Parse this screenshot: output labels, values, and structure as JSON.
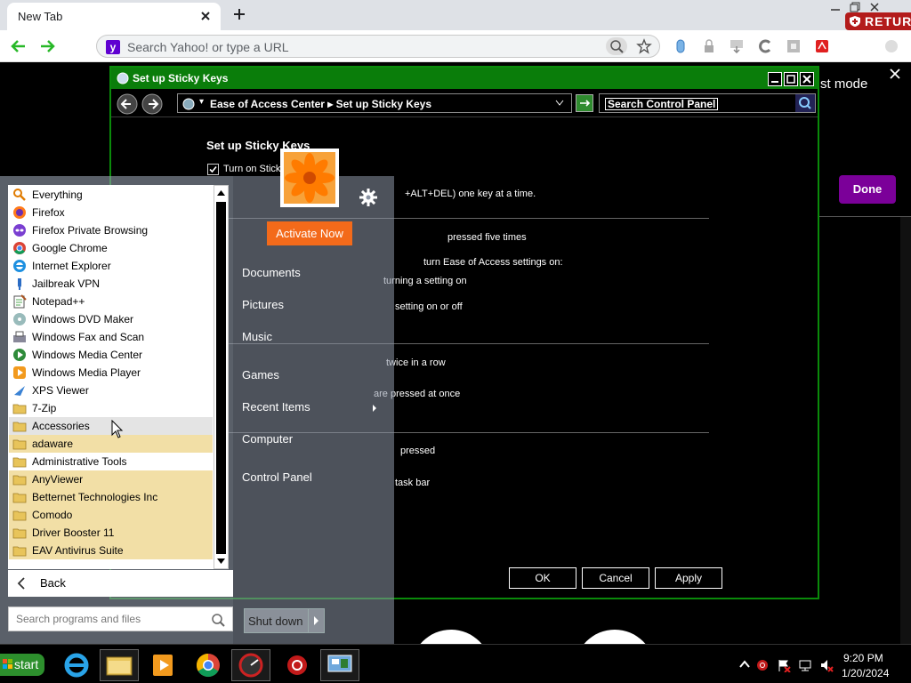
{
  "browser": {
    "tab_title": "New Tab",
    "omnibox_placeholder": "Search Yahoo! or type a URL",
    "retur_badge": "RETUR"
  },
  "page": {
    "mode_text": "st mode",
    "done_label": "Done"
  },
  "sticky_keys": {
    "window_title": "Set up Sticky Keys",
    "breadcrumb": "Ease of Access Center  ▸  Set up Sticky Keys",
    "search_placeholder": "Search Control Panel",
    "heading": "Set up Sticky Keys",
    "turn_on_label": "Turn on Sticky",
    "lines": [
      {
        "text": "+ALT+DEL) one key at a time.",
        "dim": false
      },
      {
        "text": "pressed five times",
        "dim": false
      },
      {
        "text": "turn Ease of Access settings on:",
        "dim": false
      },
      {
        "text": "turning a setting on",
        "dim": false
      },
      {
        "text": "setting on or off",
        "dim": false
      },
      {
        "text": "twice in a row",
        "dim": false
      },
      {
        "text": "are pressed at once",
        "dim": false
      },
      {
        "text": "pressed",
        "dim": false
      },
      {
        "text": "task bar",
        "dim": false
      }
    ],
    "ok_label": "OK",
    "cancel_label": "Cancel",
    "apply_label": "Apply"
  },
  "activate": {
    "button_label": "Activate Now"
  },
  "start_menu": {
    "programs": [
      {
        "label": "Everything",
        "icon": "everything-icon",
        "folder": false
      },
      {
        "label": "Firefox",
        "icon": "firefox-icon",
        "folder": false
      },
      {
        "label": "Firefox Private Browsing",
        "icon": "firefox-private-icon",
        "folder": false
      },
      {
        "label": "Google Chrome",
        "icon": "chrome-icon",
        "folder": false
      },
      {
        "label": "Internet Explorer",
        "icon": "ie-icon",
        "folder": false
      },
      {
        "label": "Jailbreak VPN",
        "icon": "vpn-icon",
        "folder": false
      },
      {
        "label": "Notepad++",
        "icon": "notepad-icon",
        "folder": false
      },
      {
        "label": "Windows DVD Maker",
        "icon": "dvd-icon",
        "folder": false
      },
      {
        "label": "Windows Fax and Scan",
        "icon": "fax-icon",
        "folder": false
      },
      {
        "label": "Windows Media Center",
        "icon": "media-center-icon",
        "folder": false
      },
      {
        "label": "Windows Media Player",
        "icon": "media-player-icon",
        "folder": false
      },
      {
        "label": "XPS Viewer",
        "icon": "xps-icon",
        "folder": false
      },
      {
        "label": "7-Zip",
        "icon": "folder-icon",
        "folder": false
      },
      {
        "label": "Accessories",
        "icon": "folder-icon",
        "folder": true,
        "hover": true
      },
      {
        "label": "adaware",
        "icon": "folder-icon",
        "folder": true
      },
      {
        "label": "Administrative Tools",
        "icon": "folder-icon",
        "folder": false
      },
      {
        "label": "AnyViewer",
        "icon": "folder-icon",
        "folder": true
      },
      {
        "label": "Betternet Technologies Inc",
        "icon": "folder-icon",
        "folder": true
      },
      {
        "label": "Comodo",
        "icon": "folder-icon",
        "folder": true
      },
      {
        "label": "Driver Booster 11",
        "icon": "folder-icon",
        "folder": true
      },
      {
        "label": "EAV Antivirus Suite",
        "icon": "folder-icon",
        "folder": true
      }
    ],
    "back_label": "Back",
    "search_placeholder": "Search programs and files",
    "shutdown_label": "Shut down",
    "places": [
      "Documents",
      "Pictures",
      "Music",
      "Games",
      "Recent Items",
      "Computer",
      "Control Panel"
    ]
  },
  "taskbar": {
    "start_label": "start",
    "time": "9:20 PM",
    "date": "1/20/2024"
  }
}
